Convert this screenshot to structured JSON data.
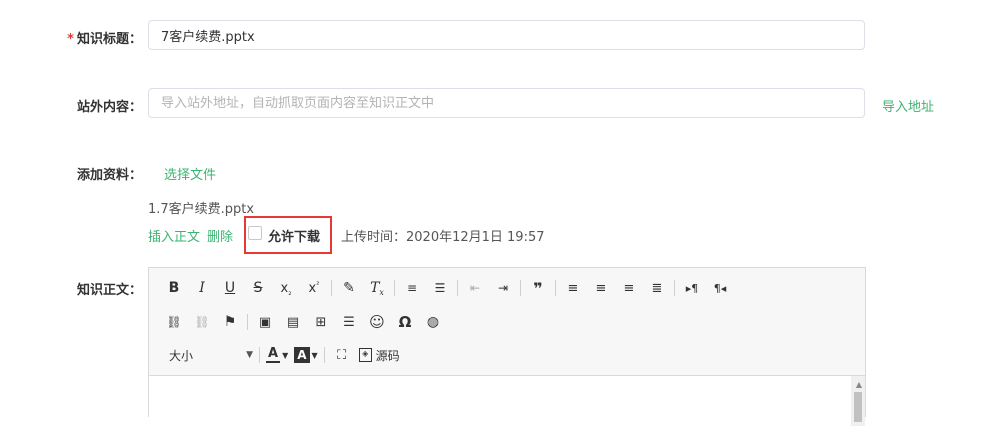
{
  "title_field": {
    "label": "知识标题：",
    "required_mark": "*",
    "value": "7客户续费.pptx"
  },
  "external": {
    "label": "站外内容：",
    "placeholder": "导入站外地址，自动抓取页面内容至知识正文中",
    "import_link": "导入地址"
  },
  "attachment": {
    "label": "添加资料：",
    "select_file": "选择文件",
    "file_name": "1.7客户续费.pptx",
    "insert_link": "插入正文",
    "delete_link": "删除",
    "allow_download": "允许下载",
    "allow_download_checked": false,
    "upload_time": "上传时间：2020年12月1日 19:57"
  },
  "body_field": {
    "label": "知识正文："
  },
  "editor": {
    "font_size": "大小",
    "source_label": "源码",
    "toolbar_icons": [
      "bold",
      "italic",
      "underline",
      "strikethrough",
      "subscript",
      "superscript",
      "format-painter",
      "clear-format",
      "ordered-list",
      "unordered-list",
      "outdent",
      "indent",
      "blockquote",
      "align-left",
      "align-center",
      "align-right",
      "justify",
      "ltr",
      "rtl",
      "link",
      "unlink",
      "anchor",
      "image",
      "media",
      "table",
      "horizontal-rule",
      "emoticon",
      "special-char",
      "map",
      "font-color",
      "background-color",
      "fullscreen",
      "source"
    ]
  },
  "colors": {
    "accent_green": "#3cb371",
    "required_red": "#e53935",
    "highlight_box": "#e53935"
  }
}
